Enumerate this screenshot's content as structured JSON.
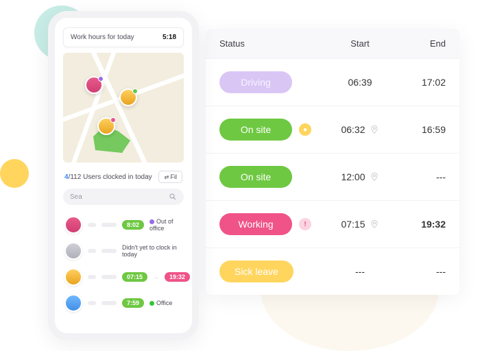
{
  "phone": {
    "work_hours_label": "Work hours for today",
    "work_hours_value": "5:18",
    "clocked_in_count": "4",
    "clocked_in_total": "/112",
    "clocked_in_text": " Users clocked in today",
    "filter_label": "Fil",
    "search_placeholder": "Sea",
    "rows": [
      {
        "pill1": "8:02",
        "status_text": "Out of office"
      },
      {
        "note": "Didn't yet to clock in today"
      },
      {
        "pill1": "07:15",
        "pill2": "19:32"
      },
      {
        "pill1": "7:59",
        "status_text": "Office"
      }
    ]
  },
  "table": {
    "headers": {
      "status": "Status",
      "start": "Start",
      "end": "End"
    },
    "rows": [
      {
        "status": "Driving",
        "start": "06:39",
        "end": "17:02",
        "geo_start": false,
        "geo_end": false
      },
      {
        "status": "On site",
        "start": "06:32",
        "end": "16:59",
        "icon": "gold",
        "geo_start": true,
        "geo_end": false
      },
      {
        "status": "On site",
        "start": "12:00",
        "end": "---",
        "geo_start": true
      },
      {
        "status": "Working",
        "start": "07:15",
        "end": "19:32",
        "icon": "alert",
        "geo_start": true,
        "end_bold": true
      },
      {
        "status": "Sick  leave",
        "start": "---",
        "end": "---"
      }
    ]
  }
}
